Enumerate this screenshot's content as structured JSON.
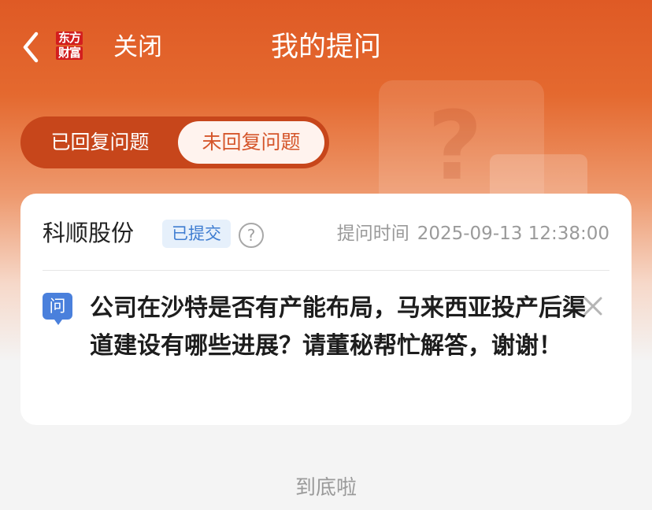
{
  "header": {
    "back_icon": "chevron-left-icon",
    "logo_line1": "东方",
    "logo_line2": "财富",
    "close_label": "关闭",
    "title": "我的提问"
  },
  "tabs": [
    {
      "label": "已回复问题",
      "selected": false
    },
    {
      "label": "未回复问题",
      "selected": true
    }
  ],
  "question_card": {
    "stock_name": "科顺股份",
    "status_badge": "已提交",
    "help_icon": "question-circle-icon",
    "time_label": "提问时间",
    "time_value": "2025-09-13 12:38:00",
    "q_icon_text": "问",
    "question_text": "公司在沙特是否有产能布局，马来西亚投产后渠道建设有哪些进展？请董秘帮忙解答，谢谢！",
    "dismiss_icon": "close-icon"
  },
  "footer": {
    "end_text": "到底啦"
  },
  "colors": {
    "brand_orange": "#df5a25",
    "tab_active_text": "#d5562b",
    "badge_blue": "#3f7dd1",
    "badge_bg": "#e6f0fb"
  }
}
